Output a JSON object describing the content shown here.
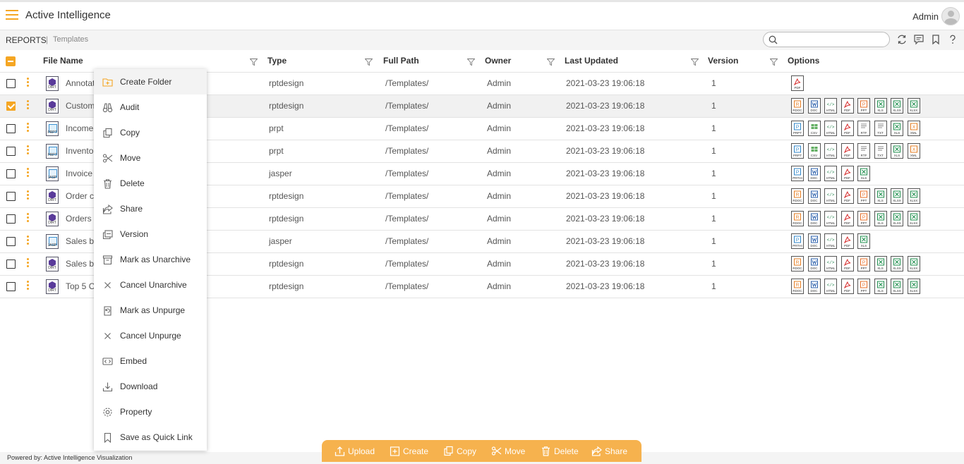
{
  "header": {
    "app_title": "Active Intelligence",
    "user": "Admin"
  },
  "breadcrumb": {
    "root": "REPORTS",
    "separator": "|",
    "current": "Templates"
  },
  "search": {
    "placeholder": "",
    "value": ""
  },
  "columns": [
    "File Name",
    "Type",
    "Full Path",
    "Owner",
    "Last Updated",
    "Version",
    "Options"
  ],
  "rows": [
    {
      "name": "Annotat",
      "icon": "DIRT",
      "type": "rptdesign",
      "path": "/Templates/",
      "owner": "Admin",
      "updated": "2021-03-23 19:06:18",
      "version": "1",
      "checked": false,
      "options": [
        "PDF"
      ]
    },
    {
      "name": "Custom",
      "icon": "DIRT",
      "type": "rptdesign",
      "path": "/Templates/",
      "owner": "Admin",
      "updated": "2021-03-23 19:06:18",
      "version": "1",
      "checked": true,
      "options": [
        "RDOC",
        "DOC",
        "HTML",
        "PDF",
        "PPT",
        "XLS",
        "XLSX",
        "XLSX"
      ]
    },
    {
      "name": "Income",
      "icon": "PRPT",
      "type": "prpt",
      "path": "/Templates/",
      "owner": "Admin",
      "updated": "2021-03-23 19:06:18",
      "version": "1",
      "checked": false,
      "options": [
        "PRPT",
        "CSV",
        "HTML",
        "PDF",
        "RTF",
        "TXT",
        "XLS",
        "XML"
      ]
    },
    {
      "name": "Invento",
      "icon": "PRPT",
      "type": "prpt",
      "path": "/Templates/",
      "owner": "Admin",
      "updated": "2021-03-23 19:06:18",
      "version": "1",
      "checked": false,
      "options": [
        "PRPT",
        "CSV",
        "HTML",
        "PDF",
        "RTF",
        "TXT",
        "XLS",
        "XML"
      ]
    },
    {
      "name": "Invoice",
      "icon": "JASP",
      "type": "jasper",
      "path": "/Templates/",
      "owner": "Admin",
      "updated": "2021-03-23 19:06:18",
      "version": "1",
      "checked": false,
      "options": [
        "PRTHI",
        "DOC",
        "HTML",
        "PDF",
        "XLS"
      ]
    },
    {
      "name": "Order c",
      "icon": "DIRT",
      "type": "rptdesign",
      "path": "/Templates/",
      "owner": "Admin",
      "updated": "2021-03-23 19:06:18",
      "version": "1",
      "checked": false,
      "options": [
        "RDOC",
        "DOC",
        "HTML",
        "PDF",
        "PPT",
        "XLS",
        "XLSX",
        "XLSX"
      ]
    },
    {
      "name": "Orders",
      "icon": "DIRT",
      "type": "rptdesign",
      "path": "/Templates/",
      "owner": "Admin",
      "updated": "2021-03-23 19:06:18",
      "version": "1",
      "checked": false,
      "options": [
        "RDOC",
        "DOC",
        "HTML",
        "PDF",
        "PPT",
        "XLS",
        "XLSX",
        "XLSX"
      ]
    },
    {
      "name": "Sales b",
      "icon": "JASP",
      "type": "jasper",
      "path": "/Templates/",
      "owner": "Admin",
      "updated": "2021-03-23 19:06:18",
      "version": "1",
      "checked": false,
      "options": [
        "PRTHI",
        "DOC",
        "HTML",
        "PDF",
        "XLS"
      ]
    },
    {
      "name": "Sales b",
      "icon": "DIRT",
      "type": "rptdesign",
      "path": "/Templates/",
      "owner": "Admin",
      "updated": "2021-03-23 19:06:18",
      "version": "1",
      "checked": false,
      "options": [
        "RDOC",
        "DOC",
        "HTML",
        "PDF",
        "PPT",
        "XLS",
        "XLSX",
        "XLSX"
      ]
    },
    {
      "name": "Top 5 C",
      "icon": "DIRT",
      "type": "rptdesign",
      "path": "/Templates/",
      "owner": "Admin",
      "updated": "2021-03-23 19:06:18",
      "version": "1",
      "checked": false,
      "options": [
        "RDOC",
        "DOC",
        "HTML",
        "PDF",
        "PPT",
        "XLS",
        "XLSX",
        "XLSX"
      ]
    }
  ],
  "context_menu": [
    {
      "label": "Create Folder",
      "icon": "folder-plus-icon"
    },
    {
      "label": "Audit",
      "icon": "binoculars-icon"
    },
    {
      "label": "Copy",
      "icon": "copy-icon"
    },
    {
      "label": "Move",
      "icon": "scissors-icon"
    },
    {
      "label": "Delete",
      "icon": "trash-icon"
    },
    {
      "label": "Share",
      "icon": "share-icon"
    },
    {
      "label": "Version",
      "icon": "version-icon"
    },
    {
      "label": "Mark as Unarchive",
      "icon": "archive-icon"
    },
    {
      "label": "Cancel Unarchive",
      "icon": "close-icon"
    },
    {
      "label": "Mark as Unpurge",
      "icon": "restore-icon"
    },
    {
      "label": "Cancel Unpurge",
      "icon": "close-icon"
    },
    {
      "label": "Embed",
      "icon": "embed-icon"
    },
    {
      "label": "Download",
      "icon": "download-icon"
    },
    {
      "label": "Property",
      "icon": "gear-icon"
    },
    {
      "label": "Save as Quick Link",
      "icon": "bookmark-icon"
    }
  ],
  "actions": [
    {
      "label": "Upload",
      "icon": "upload-icon"
    },
    {
      "label": "Create",
      "icon": "plus-icon"
    },
    {
      "label": "Copy",
      "icon": "copy-icon"
    },
    {
      "label": "Move",
      "icon": "scissors-icon"
    },
    {
      "label": "Delete",
      "icon": "trash-icon"
    },
    {
      "label": "Share",
      "icon": "share-icon"
    }
  ],
  "footer": "Powered by: Active Intelligence Visualization",
  "colors": {
    "accent": "#f5a623",
    "action_bar": "#f6b24e"
  }
}
